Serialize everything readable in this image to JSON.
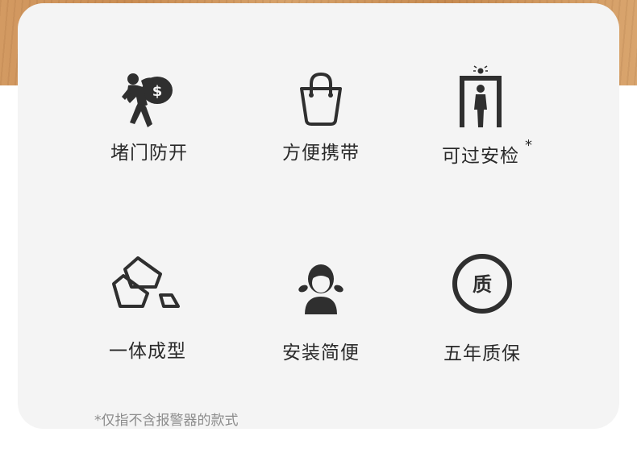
{
  "features": [
    {
      "label": "堵门防开",
      "icon": "thief-money-bag-icon"
    },
    {
      "label": "方便携带",
      "icon": "shopping-bag-icon"
    },
    {
      "label": "可过安检",
      "icon": "security-gate-icon",
      "marker": "*"
    },
    {
      "label": "一体成型",
      "icon": "metal-bars-icon"
    },
    {
      "label": "安装简便",
      "icon": "girl-icon"
    },
    {
      "label": "五年质保",
      "icon": "quality-badge-icon",
      "badge_text": "质"
    }
  ],
  "footnote": "*仅指不含报警器的款式",
  "colors": {
    "icon": "#2f2f2f",
    "card": "#f4f4f4",
    "note": "#8c8c8c"
  }
}
